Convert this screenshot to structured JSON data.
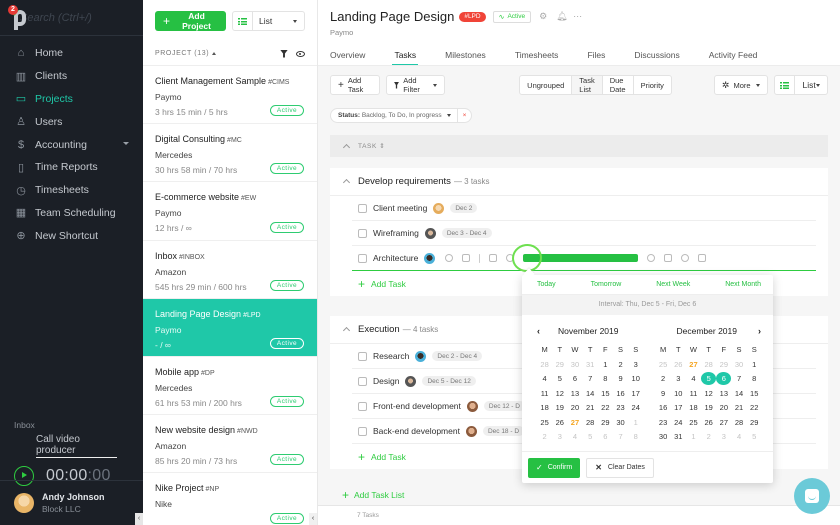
{
  "sidebar": {
    "notification_count": "2",
    "search_placeholder": "Search (Ctrl+/)",
    "nav": [
      {
        "label": "Home",
        "icon": "home-icon"
      },
      {
        "label": "Clients",
        "icon": "building-icon"
      },
      {
        "label": "Projects",
        "icon": "folder-icon",
        "active": true
      },
      {
        "label": "Users",
        "icon": "user-icon"
      },
      {
        "label": "Accounting",
        "icon": "ledger-icon",
        "has_submenu": true
      },
      {
        "label": "Time Reports",
        "icon": "bar-chart-icon"
      },
      {
        "label": "Timesheets",
        "icon": "clock-icon"
      },
      {
        "label": "Team Scheduling",
        "icon": "calendar-icon"
      },
      {
        "label": "New Shortcut",
        "icon": "plus-circle-icon"
      }
    ],
    "timer": {
      "project": "Inbox",
      "task": "Call video producer",
      "time_main": "00:00",
      "time_seconds": ":00"
    },
    "user": {
      "name": "Andy Johnson",
      "company": "Block LLC"
    }
  },
  "projects_panel": {
    "add_button": "Add Project",
    "view_selector": "List",
    "header": "PROJECT (13)",
    "projects": [
      {
        "name": "Client Management Sample",
        "code": "#CIMS",
        "client": "Paymo",
        "hours": "3 hrs 15 min / 5 hrs",
        "status": "Active"
      },
      {
        "name": "Digital Consulting",
        "code": "#MC",
        "client": "Mercedes",
        "hours": "30 hrs 58 min / 70 hrs",
        "status": "Active"
      },
      {
        "name": "E-commerce website",
        "code": "#EW",
        "client": "Paymo",
        "hours": "12 hrs / ∞",
        "status": "Active"
      },
      {
        "name": "Inbox",
        "code": "#INBOX",
        "client": "Amazon",
        "hours": "545 hrs 29 min / 600 hrs",
        "status": "Active"
      },
      {
        "name": "Landing Page Design",
        "code": "#LPD",
        "client": "Paymo",
        "hours": "- / ∞",
        "status": "Active",
        "selected": true
      },
      {
        "name": "Mobile app",
        "code": "#DP",
        "client": "Mercedes",
        "hours": "61 hrs 53 min / 200 hrs",
        "status": "Active"
      },
      {
        "name": "New website design",
        "code": "#NWD",
        "client": "Amazon",
        "hours": "85 hrs 20 min / 73 hrs",
        "status": "Active"
      },
      {
        "name": "Nike Project",
        "code": "#NP",
        "client": "Nike",
        "hours": "",
        "status": "Active"
      }
    ]
  },
  "project": {
    "title": "Landing Page Design",
    "code": "#LPD",
    "status": "Active",
    "client": "Paymo",
    "tabs": [
      "Overview",
      "Tasks",
      "Milestones",
      "Timesheets",
      "Files",
      "Discussions",
      "Activity Feed"
    ],
    "active_tab": "Tasks"
  },
  "toolbar": {
    "add_task": "Add Task",
    "add_filter": "Add Filter",
    "grouping": [
      "Ungrouped",
      "Task List",
      "Due Date",
      "Priority"
    ],
    "active_grouping": "Task List",
    "more": "More",
    "view": "List",
    "filter_label": "Status:",
    "filter_value": "Backlog, To Do, In progress",
    "filter_remove": "×"
  },
  "task_table": {
    "column_header": "TASK",
    "groups": [
      {
        "name": "Develop requirements",
        "count": "— 3 tasks",
        "tasks": [
          {
            "name": "Client meeting",
            "date": "Dec 2"
          },
          {
            "name": "Wireframing",
            "date": "Dec 3 - Dec 4"
          },
          {
            "name": "Architecture",
            "date": ""
          }
        ]
      },
      {
        "name": "Execution",
        "count": "— 4 tasks",
        "tasks": [
          {
            "name": "Research",
            "date": "Dec 2 - Dec 4"
          },
          {
            "name": "Design",
            "date": "Dec 5 - Dec 12"
          },
          {
            "name": "Front-end development",
            "date": "Dec 12 - D"
          },
          {
            "name": "Back-end development",
            "date": "Dec 18 - D"
          }
        ]
      }
    ],
    "add_task": "Add Task",
    "add_task_list": "Add Task List",
    "footer": "7 Tasks"
  },
  "date_picker": {
    "quick": [
      "Today",
      "Tomorrow",
      "Next Week",
      "Next Month"
    ],
    "interval": "Interval: Thu, Dec 5 - Fri, Dec 6",
    "weekdays": [
      "M",
      "T",
      "W",
      "T",
      "F",
      "S",
      "S"
    ],
    "months": [
      {
        "title": "November 2019",
        "days": [
          {
            "d": "28",
            "o": 1
          },
          {
            "d": "29",
            "o": 1
          },
          {
            "d": "30",
            "o": 1
          },
          {
            "d": "31",
            "o": 1
          },
          {
            "d": "1"
          },
          {
            "d": "2"
          },
          {
            "d": "3"
          },
          {
            "d": "4"
          },
          {
            "d": "5"
          },
          {
            "d": "6"
          },
          {
            "d": "7"
          },
          {
            "d": "8"
          },
          {
            "d": "9"
          },
          {
            "d": "10"
          },
          {
            "d": "11"
          },
          {
            "d": "12"
          },
          {
            "d": "13"
          },
          {
            "d": "14"
          },
          {
            "d": "15"
          },
          {
            "d": "16"
          },
          {
            "d": "17"
          },
          {
            "d": "18"
          },
          {
            "d": "19"
          },
          {
            "d": "20"
          },
          {
            "d": "21"
          },
          {
            "d": "22"
          },
          {
            "d": "23"
          },
          {
            "d": "24"
          },
          {
            "d": "25"
          },
          {
            "d": "26"
          },
          {
            "d": "27",
            "t": 1
          },
          {
            "d": "28"
          },
          {
            "d": "29"
          },
          {
            "d": "30"
          },
          {
            "d": "1",
            "o": 1
          },
          {
            "d": "2",
            "o": 1
          },
          {
            "d": "3",
            "o": 1
          },
          {
            "d": "4",
            "o": 1
          },
          {
            "d": "5",
            "o": 1
          },
          {
            "d": "6",
            "o": 1
          },
          {
            "d": "7",
            "o": 1
          },
          {
            "d": "8",
            "o": 1
          }
        ]
      },
      {
        "title": "December 2019",
        "days": [
          {
            "d": "25",
            "o": 1
          },
          {
            "d": "26",
            "o": 1
          },
          {
            "d": "27",
            "t": 1
          },
          {
            "d": "28",
            "o": 1
          },
          {
            "d": "29",
            "o": 1
          },
          {
            "d": "30",
            "o": 1
          },
          {
            "d": "1"
          },
          {
            "d": "2"
          },
          {
            "d": "3"
          },
          {
            "d": "4"
          },
          {
            "d": "5",
            "s": 1
          },
          {
            "d": "6",
            "s": 1
          },
          {
            "d": "7"
          },
          {
            "d": "8"
          },
          {
            "d": "9"
          },
          {
            "d": "10"
          },
          {
            "d": "11"
          },
          {
            "d": "12"
          },
          {
            "d": "13"
          },
          {
            "d": "14"
          },
          {
            "d": "15"
          },
          {
            "d": "16"
          },
          {
            "d": "17"
          },
          {
            "d": "18"
          },
          {
            "d": "19"
          },
          {
            "d": "20"
          },
          {
            "d": "21"
          },
          {
            "d": "22"
          },
          {
            "d": "23"
          },
          {
            "d": "24"
          },
          {
            "d": "25"
          },
          {
            "d": "26"
          },
          {
            "d": "27"
          },
          {
            "d": "28"
          },
          {
            "d": "29"
          },
          {
            "d": "30"
          },
          {
            "d": "31"
          },
          {
            "d": "1",
            "o": 1
          },
          {
            "d": "2",
            "o": 1
          },
          {
            "d": "3",
            "o": 1
          },
          {
            "d": "4",
            "o": 1
          },
          {
            "d": "5",
            "o": 1
          }
        ]
      }
    ],
    "confirm": "Confirm",
    "clear": "Clear Dates"
  },
  "colors": {
    "accent_teal": "#1fc8a8",
    "primary_green": "#26c043",
    "danger_red": "#f04438",
    "today_orange": "#f5a623",
    "sidebar_bg": "#1b1f26",
    "chat_blue": "#6bcad8"
  }
}
